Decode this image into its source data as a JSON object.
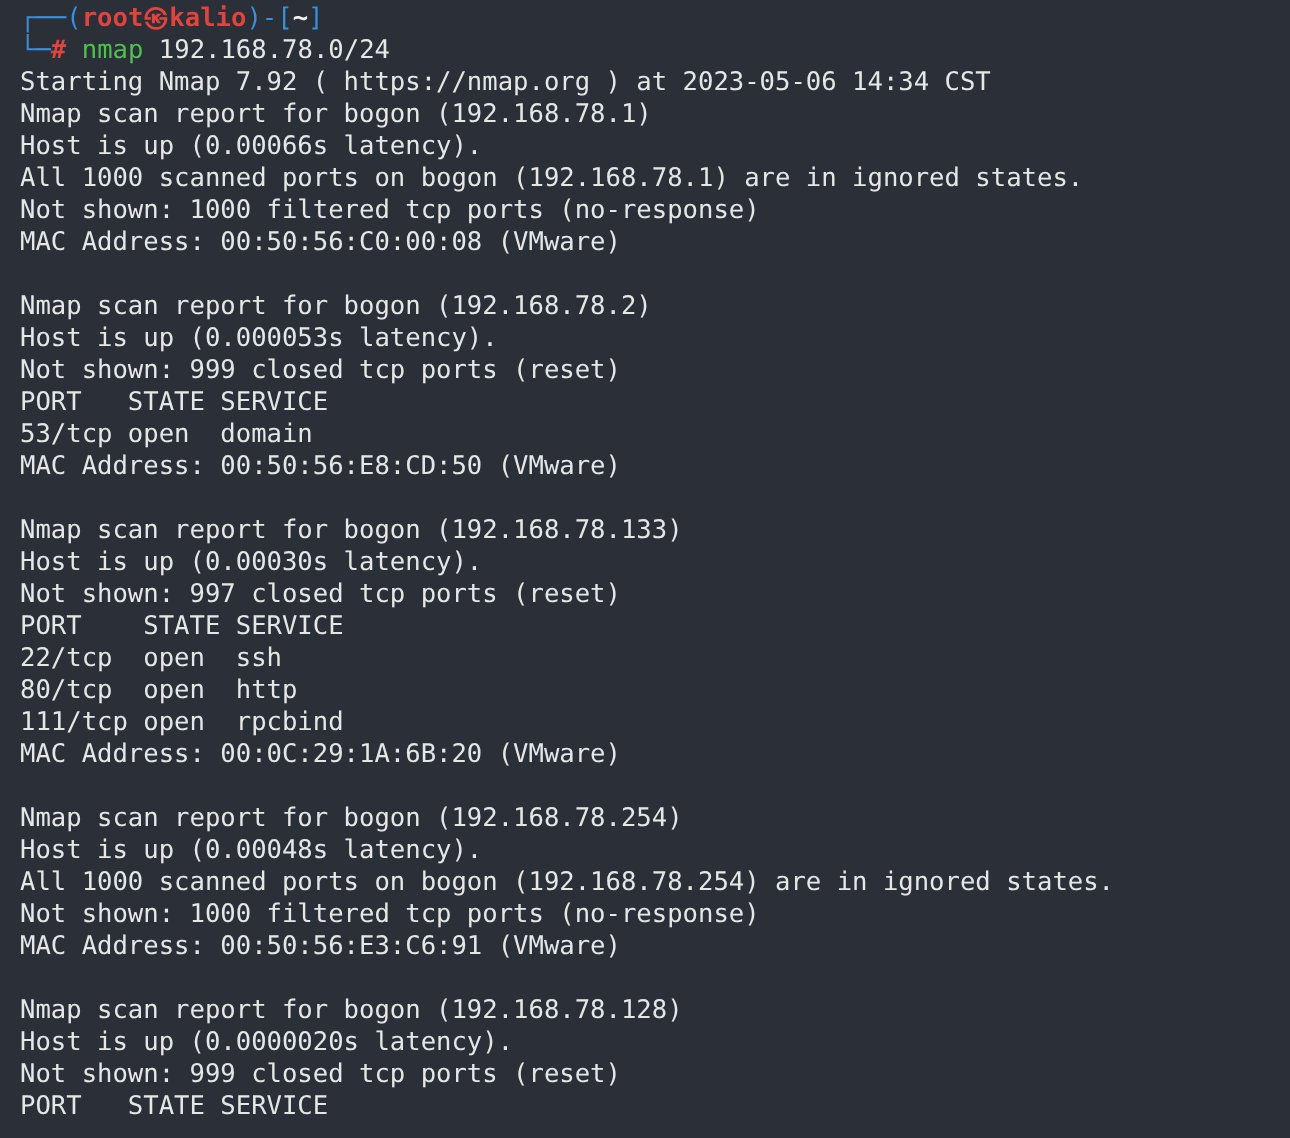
{
  "prompt": {
    "frame_top": "┌──(",
    "user": "root",
    "at": "㉿",
    "host": "kalio",
    "mid": ")-[",
    "cwd": "~",
    "end": "]",
    "frame_bottom": "└─",
    "symbol": "#",
    "command": "nmap",
    "arguments": "192.168.78.0/24"
  },
  "output": [
    [
      "Starting Nmap 7.92 ( https://nmap.org ) at 2023-05-06 14:34 CST",
      "Nmap scan report for bogon (192.168.78.1)",
      "Host is up (0.00066s latency).",
      "All 1000 scanned ports on bogon (192.168.78.1) are in ignored states.",
      "Not shown: 1000 filtered tcp ports (no-response)",
      "MAC Address: 00:50:56:C0:00:08 (VMware)"
    ],
    [
      "Nmap scan report for bogon (192.168.78.2)",
      "Host is up (0.000053s latency).",
      "Not shown: 999 closed tcp ports (reset)",
      "PORT   STATE SERVICE",
      "53/tcp open  domain",
      "MAC Address: 00:50:56:E8:CD:50 (VMware)"
    ],
    [
      "Nmap scan report for bogon (192.168.78.133)",
      "Host is up (0.00030s latency).",
      "Not shown: 997 closed tcp ports (reset)",
      "PORT    STATE SERVICE",
      "22/tcp  open  ssh",
      "80/tcp  open  http",
      "111/tcp open  rpcbind",
      "MAC Address: 00:0C:29:1A:6B:20 (VMware)"
    ],
    [
      "Nmap scan report for bogon (192.168.78.254)",
      "Host is up (0.00048s latency).",
      "All 1000 scanned ports on bogon (192.168.78.254) are in ignored states.",
      "Not shown: 1000 filtered tcp ports (no-response)",
      "MAC Address: 00:50:56:E3:C6:91 (VMware)"
    ],
    [
      "Nmap scan report for bogon (192.168.78.128)",
      "Host is up (0.0000020s latency).",
      "Not shown: 999 closed tcp ports (reset)",
      "PORT   STATE SERVICE"
    ]
  ]
}
